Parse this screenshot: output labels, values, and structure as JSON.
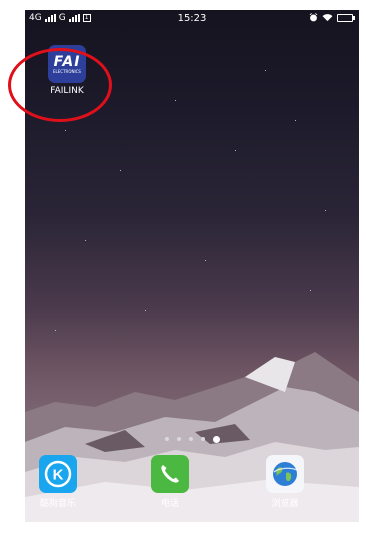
{
  "status_bar": {
    "network_label": "4G",
    "network2_label": "G",
    "sim_label": "1",
    "time": "15:23"
  },
  "home": {
    "apps": [
      {
        "label": "FAILINK",
        "logo_text": "FAI",
        "logo_subtext": "ELECTRONICS",
        "icon": "failink-app-icon"
      }
    ],
    "page_dots": {
      "count": 5,
      "active_index": 4
    }
  },
  "dock": {
    "apps": [
      {
        "label": "酷狗音乐",
        "icon": "kugou-music-icon",
        "glyph": "K"
      },
      {
        "label": "电话",
        "icon": "phone-icon"
      },
      {
        "label": "浏览器",
        "icon": "browser-globe-icon"
      }
    ]
  },
  "colors": {
    "highlight": "#e0101a",
    "failink_tile": "#2d3f9a",
    "kugou_tile": "#1aa6ee",
    "phone_tile": "#4bb841"
  }
}
